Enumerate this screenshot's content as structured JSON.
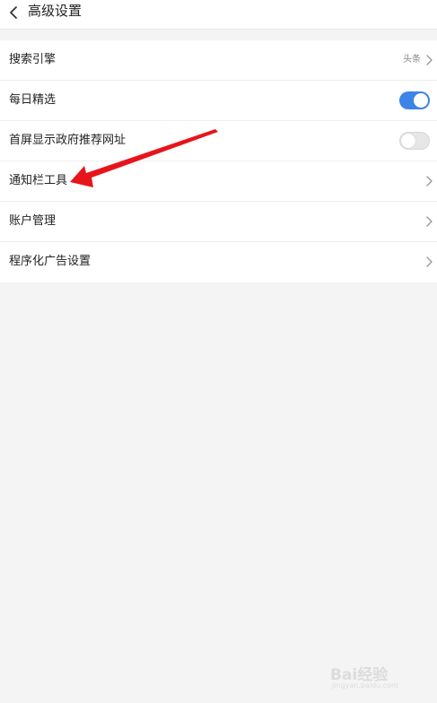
{
  "header": {
    "title": "高级设置",
    "back_icon": "chevron-left-icon"
  },
  "settings": {
    "items": [
      {
        "label": "搜索引擎",
        "value": "头条",
        "control": "chevron"
      },
      {
        "label": "每日精选",
        "control": "toggle",
        "toggle_on": true
      },
      {
        "label": "首屏显示政府推荐网址",
        "control": "toggle",
        "toggle_on": false
      },
      {
        "label": "通知栏工具",
        "control": "chevron"
      },
      {
        "label": "账户管理",
        "control": "chevron"
      },
      {
        "label": "程序化广告设置",
        "control": "chevron"
      }
    ]
  },
  "annotation": {
    "arrow_color": "#e8141b"
  },
  "watermark": {
    "main": "Bai经验",
    "sub": "jingyan.baidu.com"
  },
  "colors": {
    "toggle_on": "#3c84e6",
    "toggle_off": "#e6e6e6",
    "background": "#f4f4f4"
  }
}
